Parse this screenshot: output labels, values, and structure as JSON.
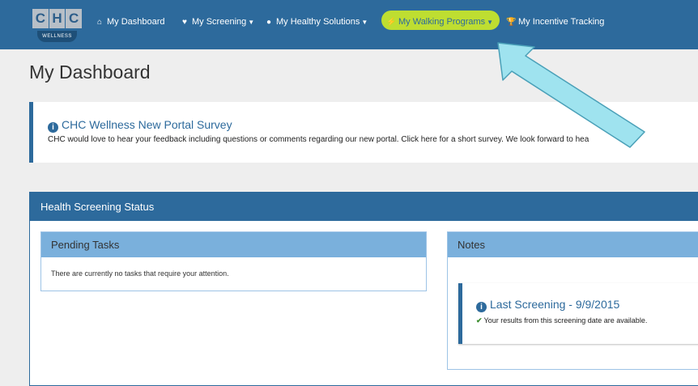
{
  "logo": {
    "letters": [
      "C",
      "H",
      "C"
    ],
    "subtitle": "WELLNESS"
  },
  "nav": {
    "items": [
      {
        "label": "My Dashboard",
        "icon": "home-icon",
        "glyph": "⌂",
        "dropdown": false
      },
      {
        "label": "My Screening",
        "icon": "heart-icon",
        "glyph": "♥",
        "dropdown": true
      },
      {
        "label": "My Healthy Solutions",
        "icon": "apple-icon",
        "glyph": "●",
        "dropdown": true
      },
      {
        "label": "My Walking Programs",
        "icon": "footprints-icon",
        "glyph": "⚡",
        "dropdown": true,
        "highlighted": true
      },
      {
        "label": "My Incentive Tracking",
        "icon": "trophy-icon",
        "glyph": "🏆",
        "dropdown": false
      }
    ],
    "highlight_color": "#c6e52b"
  },
  "page_title": "My Dashboard",
  "alert": {
    "title": "CHC Wellness New Portal Survey",
    "body": "CHC would love to hear your feedback including questions or comments regarding our new portal. Click here for a short survey. We look forward to hea"
  },
  "health_panel": {
    "title": "Health Screening Status",
    "pending": {
      "title": "Pending Tasks",
      "text": "There are currently no tasks that require your attention."
    },
    "notes": {
      "title": "Notes",
      "screening_title": "Last Screening - 9/9/2015",
      "screening_desc": "Your results from this screening date are available."
    }
  },
  "colors": {
    "brand": "#2d6a9c",
    "sub_header": "#7ab0dc",
    "check": "#3c8d2f",
    "arrow": "#9fe3ef"
  }
}
